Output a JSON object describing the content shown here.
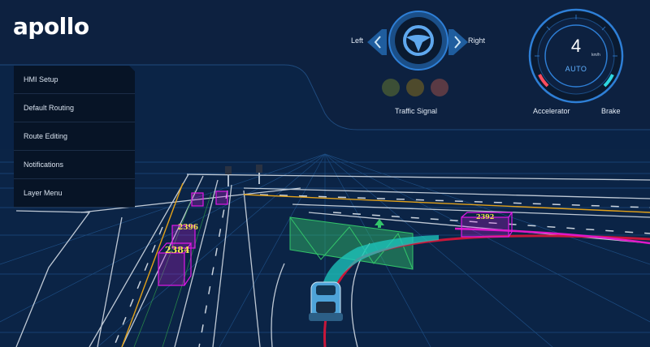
{
  "app": {
    "logo": "apollo"
  },
  "menu": {
    "items": [
      {
        "label": "HMI Setup"
      },
      {
        "label": "Default Routing"
      },
      {
        "label": "Route Editing"
      },
      {
        "label": "Notifications"
      },
      {
        "label": "Layer Menu"
      }
    ]
  },
  "steering": {
    "left_label": "Left",
    "right_label": "Right",
    "icon": "steering-wheel-icon"
  },
  "traffic_signal": {
    "title": "Traffic Signal",
    "lights": [
      "red",
      "yellow",
      "green"
    ]
  },
  "speedometer": {
    "speed": "4",
    "unit": "km/h",
    "mode": "AUTO",
    "accelerator_label": "Accelerator",
    "brake_label": "Brake"
  },
  "scene": {
    "obstacles": [
      {
        "id": "2396"
      },
      {
        "id": "2384"
      },
      {
        "id": "2392"
      }
    ]
  },
  "colors": {
    "background": "#0b2446",
    "header_panel": "#0d2140",
    "menu_bg": "#071426",
    "accent_blue": "#2e7fd6",
    "gauge_blue": "#5fb0ff",
    "obstacle_magenta": "#e018e6",
    "label_yellow": "#f2e44a",
    "route_red": "#c8173a",
    "path_teal": "#1ec8c0",
    "stop_fence_green": "#33c46a",
    "lane_yellow": "#e3a21a"
  }
}
